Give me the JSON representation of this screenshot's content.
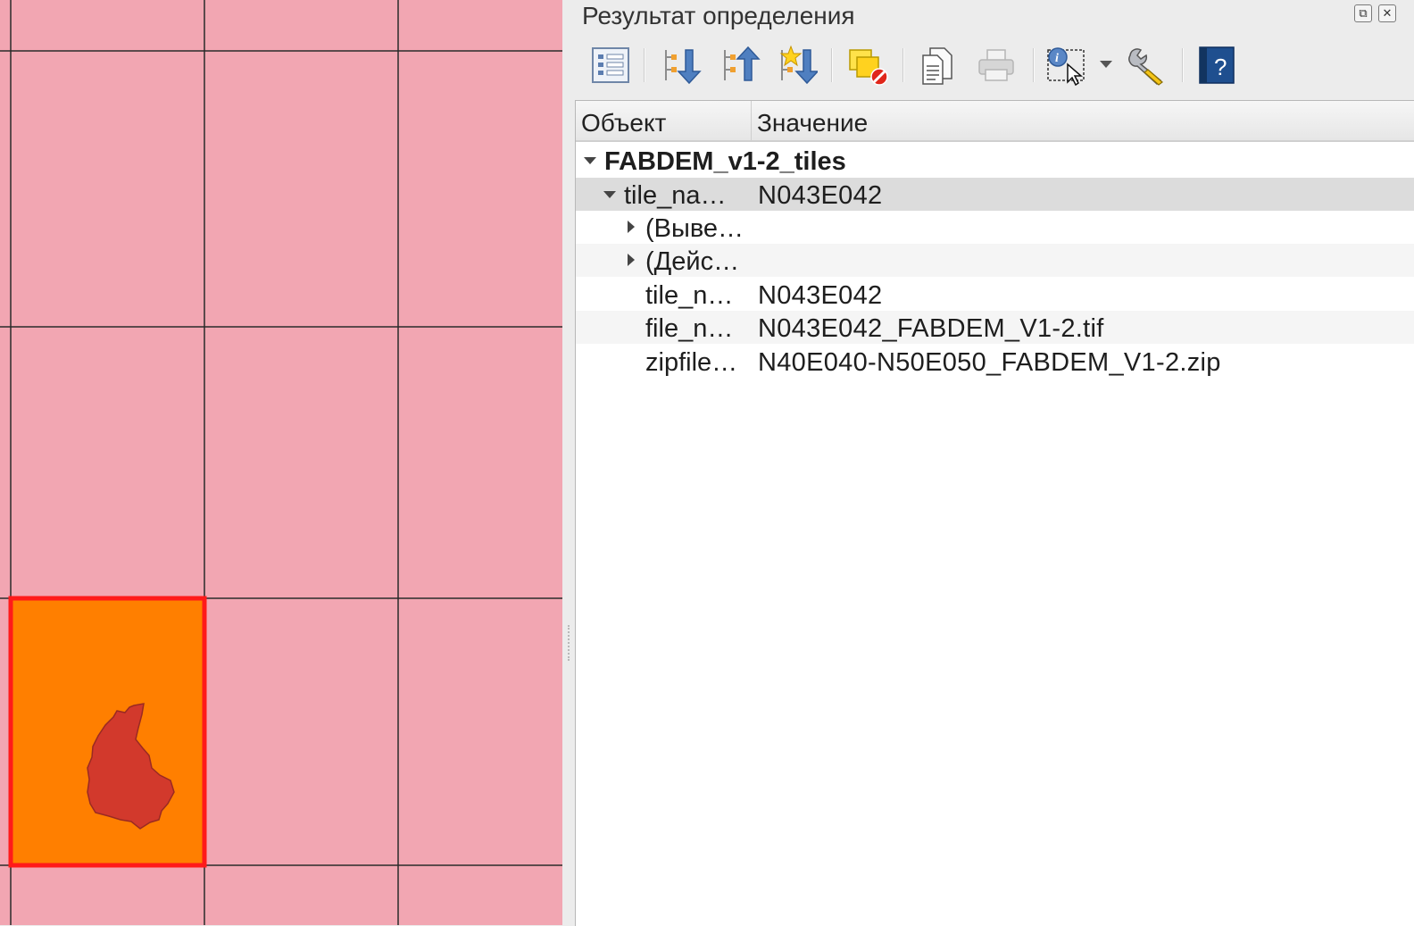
{
  "panel": {
    "title": "Результат определения",
    "dock_float_glyph": "⧉",
    "dock_close_glyph": "✕"
  },
  "toolbar": {
    "buttons": [
      {
        "icon": "form-view-icon"
      },
      {
        "icon": "expand-tree-icon"
      },
      {
        "icon": "collapse-tree-icon"
      },
      {
        "icon": "expand-new-results-icon"
      },
      {
        "icon": "clear-results-icon"
      },
      {
        "icon": "copy-feature-icon"
      },
      {
        "icon": "print-icon"
      },
      {
        "icon": "identify-select-mode-icon"
      },
      {
        "icon": "settings-wrench-icon"
      },
      {
        "icon": "help-icon"
      }
    ]
  },
  "tree": {
    "columns": [
      "Объект",
      "Значение"
    ],
    "layer": "FABDEM_v1-2_tiles",
    "feature": {
      "name": "tile_na…",
      "value": "N043E042"
    },
    "derived": "(Выве…",
    "actions": "(Дейс…",
    "attributes": [
      {
        "name": "tile_n…",
        "value": "N043E042"
      },
      {
        "name": "file_n…",
        "value": "N043E042_FABDEM_V1-2.tif"
      },
      {
        "name": "zipfile…",
        "value": "N40E040-N50E050_FABDEM_V1-2.zip"
      }
    ]
  },
  "colors": {
    "map_background": "#f2a6b2",
    "grid_lines": "#2b2b2b",
    "selected_tile_fill": "#ff7f00",
    "selected_tile_border": "#ff1a1a",
    "polygon_fill": "#d2392c"
  }
}
